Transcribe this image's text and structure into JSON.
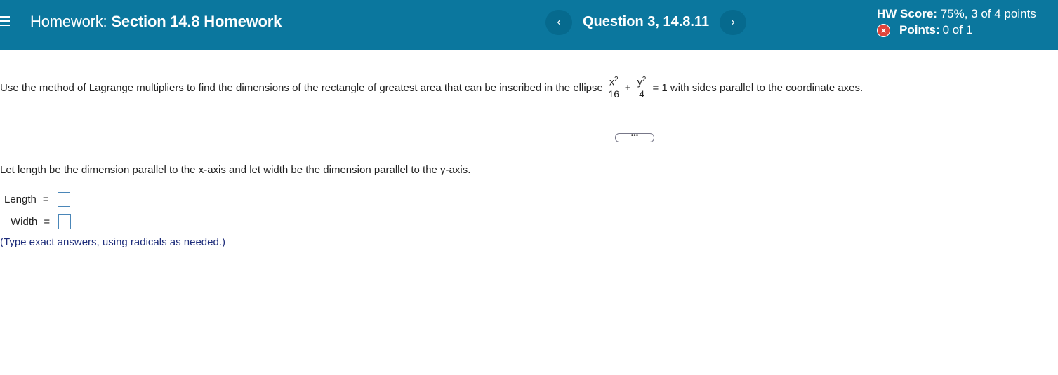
{
  "header": {
    "homework_label": "Homework:",
    "homework_name": "Section 14.8 Homework",
    "prev_label": "‹",
    "next_label": "›",
    "question_title": "Question 3, 14.8.11",
    "score_label": "HW Score:",
    "score_value": "75%, 3 of 4 points",
    "points_label": "Points:",
    "points_value": "0 of 1",
    "status_icon": "x-circle-icon",
    "colors": {
      "bar": "#0b779e",
      "incorrect": "#e0453b"
    }
  },
  "problem": {
    "text_before": "Use the method of Lagrange multipliers to find the dimensions of the rectangle of greatest area that can be inscribed in the ellipse",
    "frac1_num_base": "x",
    "frac1_num_exp": "2",
    "frac1_den": "16",
    "plus": "+",
    "frac2_num_base": "y",
    "frac2_num_exp": "2",
    "frac2_den": "4",
    "text_after": "= 1 with sides parallel to the coordinate axes."
  },
  "more_button": "•••",
  "answers": {
    "instruction": "Let length be the dimension parallel to the x-axis and let width be the dimension parallel to the y-axis.",
    "length_label": "Length",
    "width_label": "Width",
    "equals": "=",
    "length_value": "",
    "width_value": "",
    "hint": "(Type exact answers, using radicals as needed.)"
  }
}
